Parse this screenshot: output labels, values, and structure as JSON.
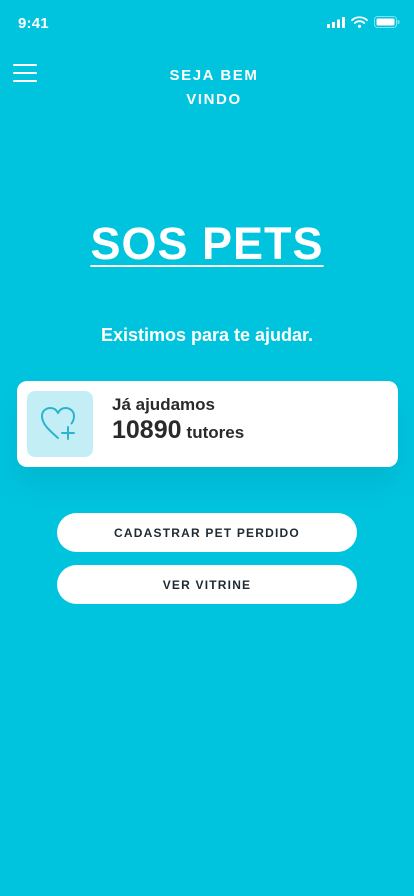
{
  "status_bar": {
    "time": "9:41",
    "icons": [
      "cellular-signal-icon",
      "wifi-icon",
      "battery-icon"
    ]
  },
  "header": {
    "menu_icon": "hamburger-menu-icon",
    "welcome_line1": "SEJA BEM",
    "welcome_line2": "VINDO"
  },
  "brand": {
    "title": "SOS PETS"
  },
  "tagline": "Existimos para te ajudar.",
  "stats": {
    "icon": "heart-plus-icon",
    "label": "Já ajudamos",
    "count": "10890",
    "unit": "tutores"
  },
  "actions": {
    "register_lost_pet": "CADASTRAR PET PERDIDO",
    "view_showcase": "VER VITRINE"
  },
  "colors": {
    "background": "#00C4DE",
    "card": "#FFFFFF",
    "icon_box": "#C4EEF6",
    "icon_stroke": "#2AB5CC",
    "dark_text": "#2A2A2A"
  }
}
